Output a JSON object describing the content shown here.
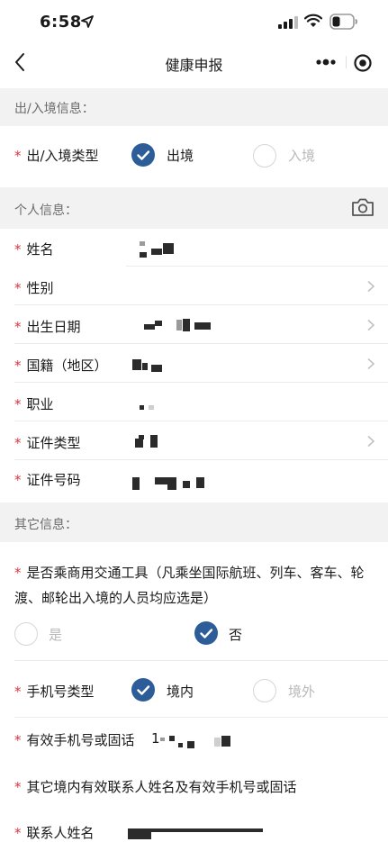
{
  "status_bar": {
    "time": "6:58"
  },
  "nav": {
    "title": "健康申报"
  },
  "sections": {
    "travel": "出/入境信息：",
    "personal": "个人信息：",
    "other": "其它信息："
  },
  "travel": {
    "label": "出/入境类型",
    "options": [
      "出境",
      "入境"
    ],
    "selected": "出境"
  },
  "personal": {
    "name": "姓名",
    "gender": "性别",
    "birth": "出生日期",
    "nationality": "国籍（地区）",
    "occupation": "职业",
    "id_type": "证件类型",
    "id_number": "证件号码"
  },
  "other": {
    "transport_question": "是否乘商用交通工具（凡乘坐国际航班、列车、客车、轮渡、邮轮出入境的人员均应选是）",
    "transport_options": [
      "是",
      "否"
    ],
    "transport_selected": "否",
    "phone_type_label": "手机号类型",
    "phone_type_options": [
      "境内",
      "境外"
    ],
    "phone_type_selected": "境内",
    "phone_label": "有效手机号或固话",
    "phone_prefix": "1",
    "contact_question": "其它境内有效联系人姓名及有效手机号或固话",
    "contact_name_label": "联系人姓名"
  },
  "colors": {
    "accent": "#2c5d99",
    "required": "#d9363e",
    "section_bg": "#f2f2f2"
  },
  "icons": [
    "location-arrow-icon",
    "signal-icon",
    "wifi-icon",
    "battery-icon",
    "back-chevron-icon",
    "more-icon",
    "close-target-icon",
    "camera-icon",
    "chevron-right-icon",
    "check-icon"
  ]
}
